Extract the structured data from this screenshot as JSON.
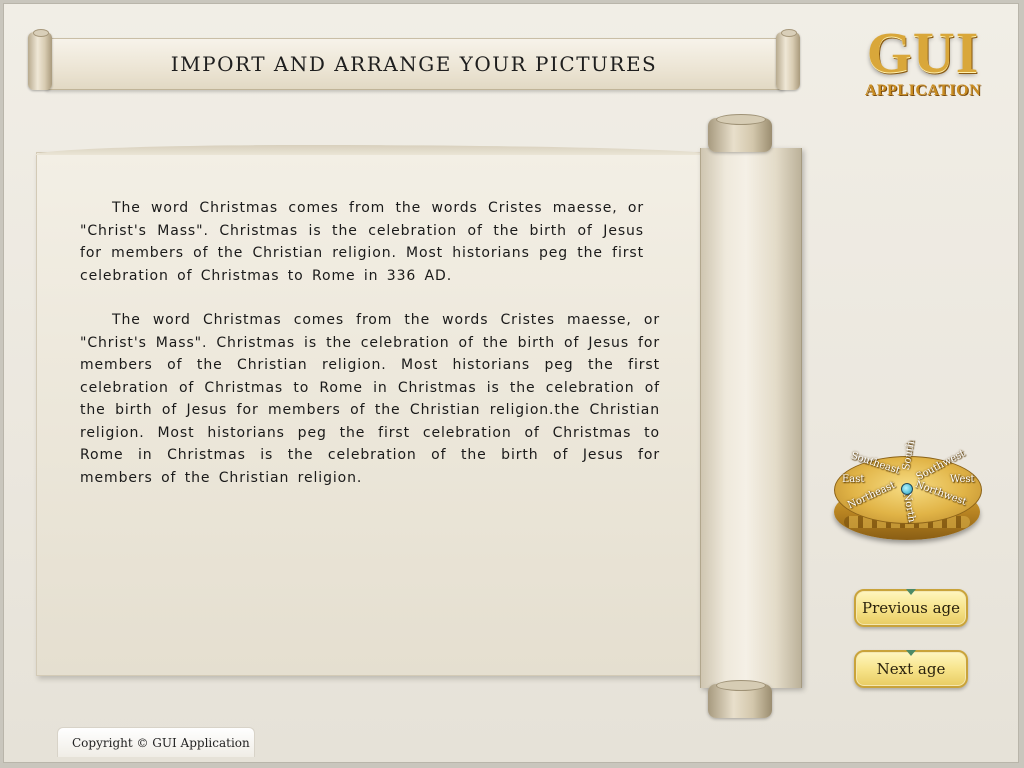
{
  "header": {
    "title": "IMPORT AND ARRANGE YOUR PICTURES"
  },
  "logo": {
    "main": "GUI",
    "sub": "APPLICATION"
  },
  "content": {
    "paragraphs": [
      "The word Christmas comes from the words Cristes maesse, or \"Christ's Mass\". Christmas is the celebration of the birth of Jesus for members of the Christian religion. Most historians peg the first celebration of Christmas to Rome in 336 AD.",
      "The word Christmas comes from the words Cristes maesse, or \"Christ's Mass\". Christmas is the celebration of the birth of Jesus for members of the Christian religion. Most historians peg the first celebration of Christmas to Rome in Christmas is the celebration of the birth of Jesus for members of the Christian religion.the Christian religion. Most historians peg the first celebration of Christmas to Rome in Christmas is the celebration of the birth of Jesus for members of the Christian religion."
    ]
  },
  "compass": {
    "labels": [
      "Southeast",
      "South",
      "Southwest",
      "East",
      "West",
      "Northeast",
      "North",
      "Northwest"
    ]
  },
  "navigation": {
    "previous_label": "Previous age",
    "next_label": "Next age"
  },
  "footer": {
    "copyright": "Copyright © GUI Application"
  },
  "colors": {
    "background": "#ebe7de",
    "gold": "#d9a73a",
    "button": "#f7e48b"
  }
}
